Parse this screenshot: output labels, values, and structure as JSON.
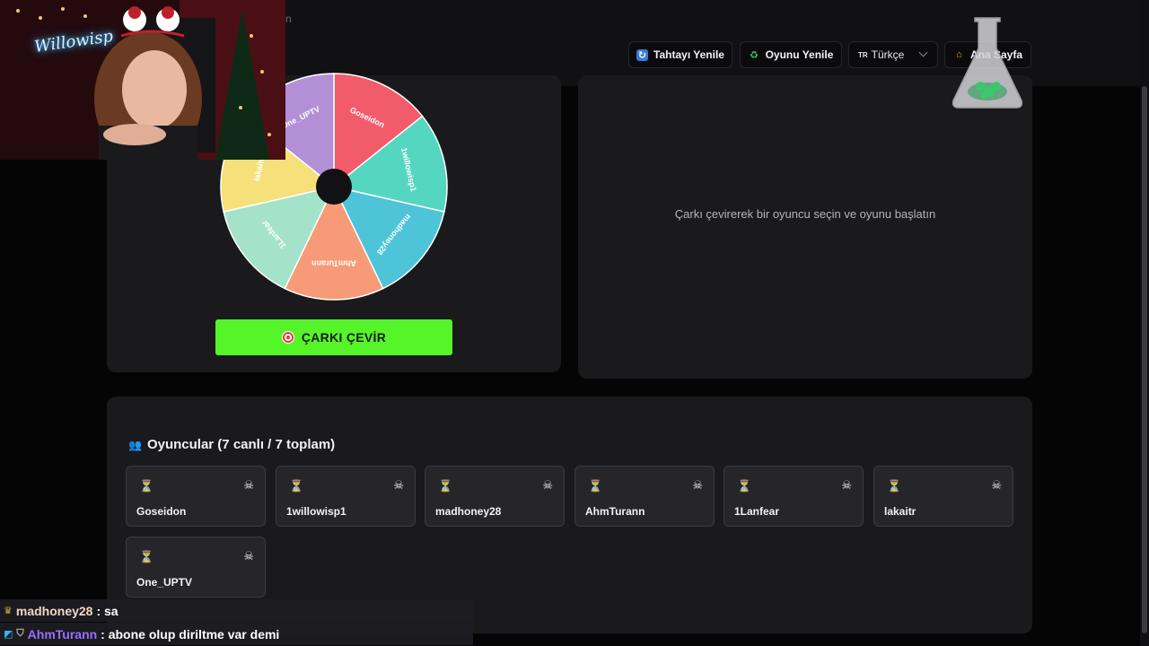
{
  "header": {
    "title_fragment": "n",
    "refresh_board": "Tahtayı Yenile",
    "restart_game": "Oyunu Yenile",
    "language_flag": "TR",
    "language": "Türkçe",
    "home": "Ana Sayfa"
  },
  "wheel": {
    "segments": [
      {
        "label": "Goseidon",
        "color": "#f25b6a"
      },
      {
        "label": "1willowisp1",
        "color": "#55d6c0"
      },
      {
        "label": "madhoney28",
        "color": "#4dc4d8"
      },
      {
        "label": "AhmTurann",
        "color": "#f79a78"
      },
      {
        "label": "1Lanfear",
        "color": "#a4e3c9"
      },
      {
        "label": "lakaitr",
        "color": "#f5e07a"
      },
      {
        "label": "One_UPTV",
        "color": "#b38fd6"
      }
    ],
    "spin_button": "ÇARKI ÇEVİR"
  },
  "status": {
    "message": "Çarkı çevirerek bir oyuncu seçin ve oyunu başlatın"
  },
  "players": {
    "title": "Oyuncular (7 canlı / 7 toplam)",
    "list": [
      "Goseidon",
      "1willowisp1",
      "madhoney28",
      "AhmTurann",
      "1Lanfear",
      "lakaitr",
      "One_UPTV"
    ]
  },
  "chat": [
    {
      "user": "madhoney28",
      "message": ": sa"
    },
    {
      "user": "AhmTurann",
      "message": ": abone olup diriltme var demi"
    }
  ],
  "webcam": {
    "neon_text": "Willowisp"
  },
  "colors": {
    "spin_button": "#55f52a",
    "panel": "#1a1a1d",
    "background": "#050506"
  }
}
